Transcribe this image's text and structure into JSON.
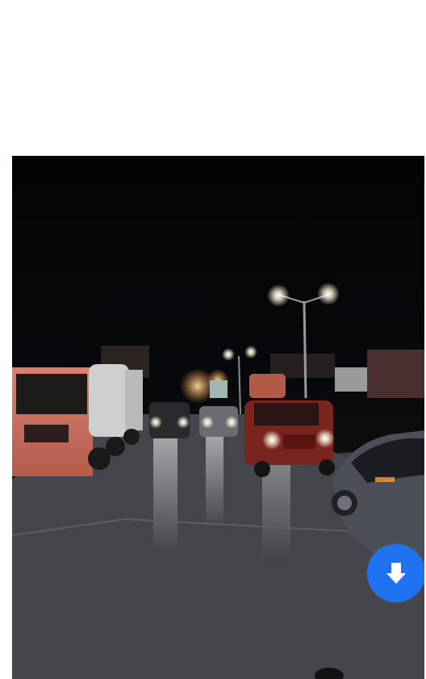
{
  "viewer": {
    "media": {
      "kind": "video-frame",
      "scene": "night-road-traffic"
    },
    "download_button": {
      "icon": "download-arrow-icon",
      "color": "#1f73f0",
      "icon_color": "#ffffff"
    }
  }
}
